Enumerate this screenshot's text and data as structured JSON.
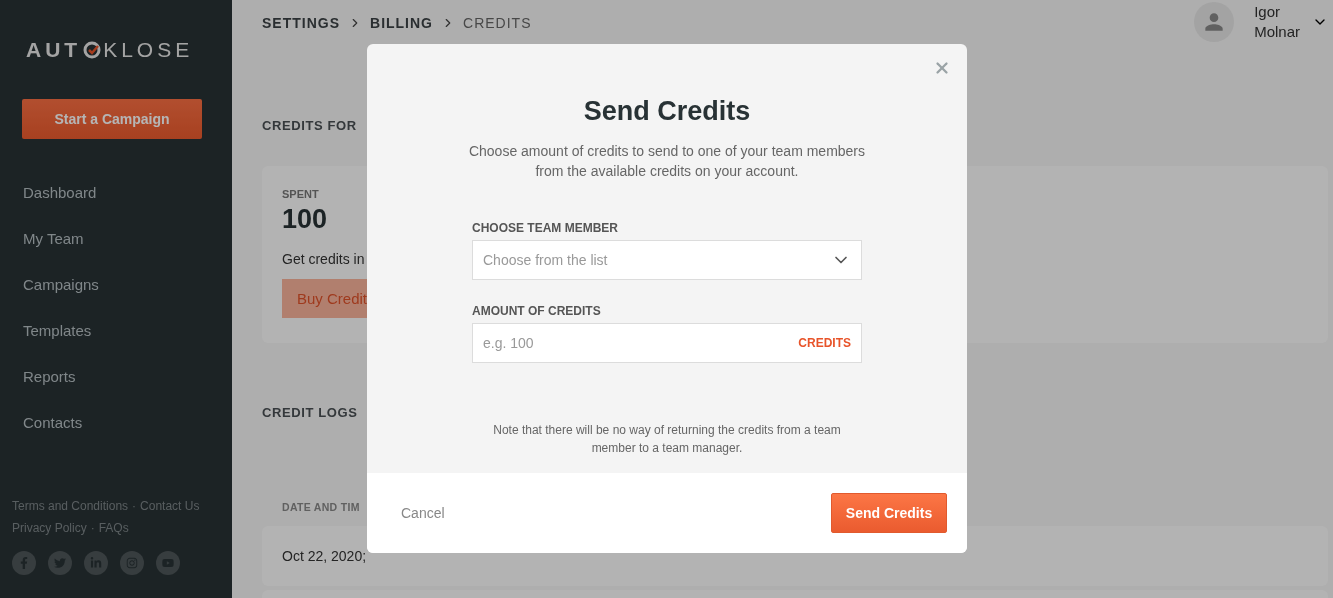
{
  "sidebar": {
    "logo": {
      "left": "AUT",
      "right": "KLOSE"
    },
    "cta": "Start a Campaign",
    "items": [
      {
        "label": "Dashboard"
      },
      {
        "label": "My Team"
      },
      {
        "label": "Campaigns"
      },
      {
        "label": "Templates"
      },
      {
        "label": "Reports"
      },
      {
        "label": "Contacts"
      }
    ],
    "footer_links": [
      [
        "Terms and Conditions",
        "Contact Us"
      ],
      [
        "Privacy Policy",
        "FAQs"
      ]
    ],
    "separator": "·"
  },
  "breadcrumb": [
    "SETTINGS",
    "BILLING",
    "CREDITS"
  ],
  "user": {
    "first": "Igor",
    "last": "Molnar"
  },
  "main": {
    "section_title": "CREDITS FOR",
    "spent_label": "SPENT",
    "spent_value": "100",
    "card_text": "Get credits in",
    "buy_button": "Buy Credit",
    "logs_title": "CREDIT LOGS",
    "column_1": "DATE AND TIM",
    "rows": [
      {
        "date": "Oct 22, 2020;"
      }
    ]
  },
  "modal": {
    "title": "Send Credits",
    "description": "Choose amount of credits to send to one of your team members from the available credits on your account.",
    "member_label": "CHOOSE TEAM MEMBER",
    "member_placeholder": "Choose from the list",
    "amount_label": "AMOUNT OF CREDITS",
    "amount_placeholder": "e.g. 100",
    "amount_unit": "CREDITS",
    "note": "Note that there will be no way of returning the credits from a team member to a team manager.",
    "cancel": "Cancel",
    "submit": "Send Credits"
  }
}
